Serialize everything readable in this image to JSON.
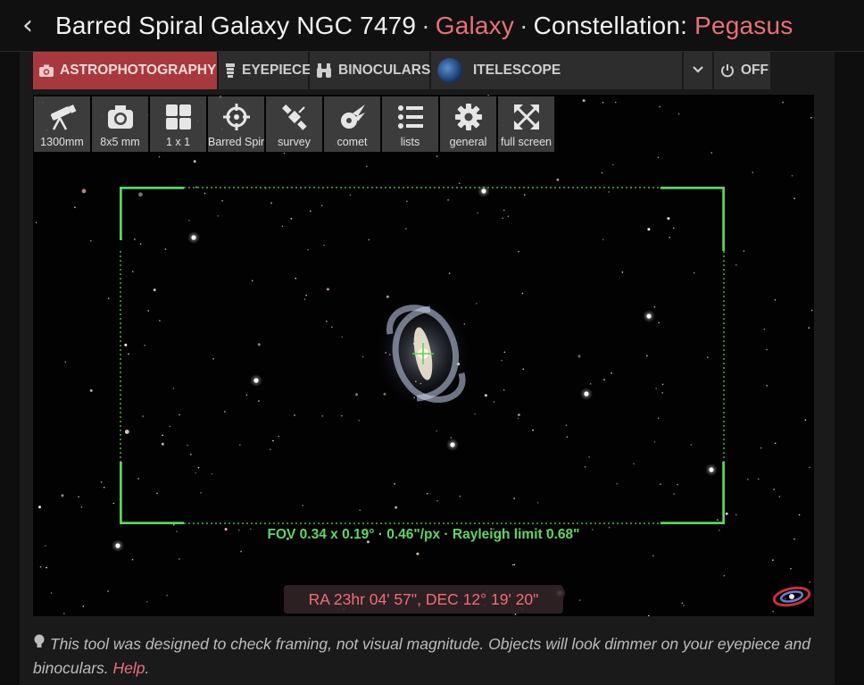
{
  "header": {
    "title": "Barred Spiral Galaxy NGC 7479",
    "separator": "·",
    "type": "Galaxy",
    "constellation_label": "Constellation:",
    "constellation": "Pegasus"
  },
  "tabs": [
    {
      "label": "ASTROPHOTOGRAPHY",
      "icon": "camera-icon",
      "active": true
    },
    {
      "label": "EYEPIECE",
      "icon": "eyepiece-icon",
      "active": false
    },
    {
      "label": "BINOCULARS",
      "icon": "binoculars-icon",
      "active": false
    },
    {
      "label": "ITELESCOPE",
      "icon": "itelescope-avatar",
      "active": false
    },
    {
      "label": "",
      "icon": "chevron-down-icon",
      "active": false
    },
    {
      "label": "OFF",
      "icon": "power-icon",
      "active": false
    }
  ],
  "toolbar": [
    {
      "label": "1300mm",
      "icon": "telescope-icon"
    },
    {
      "label": "8x5 mm",
      "icon": "camera-icon"
    },
    {
      "label": "1 x 1",
      "icon": "grid-icon"
    },
    {
      "label": "Barred Spir",
      "icon": "crosshair-icon"
    },
    {
      "label": "survey",
      "icon": "satellite-icon"
    },
    {
      "label": "comet",
      "icon": "comet-icon"
    },
    {
      "label": "lists",
      "icon": "list-icon"
    },
    {
      "label": "general",
      "icon": "gear-icon"
    },
    {
      "label": "full screen",
      "icon": "fullscreen-icon"
    }
  ],
  "viewer": {
    "fov_text": "FOV 0.34 x 0.19° · 0.46\"/px · Rayleigh limit 0.68\"",
    "coordinates": "RA 23hr 04' 57\", DEC 12° 19' 20\""
  },
  "note": {
    "text": "This tool was designed to check framing, not visual magnitude. Objects will look dimmer on your eyepiece and binoculars.",
    "help_link": "Help"
  },
  "colors": {
    "accent": "#e8707a",
    "active_tab": "#a7393e",
    "fov_frame": "#5cd35f"
  }
}
